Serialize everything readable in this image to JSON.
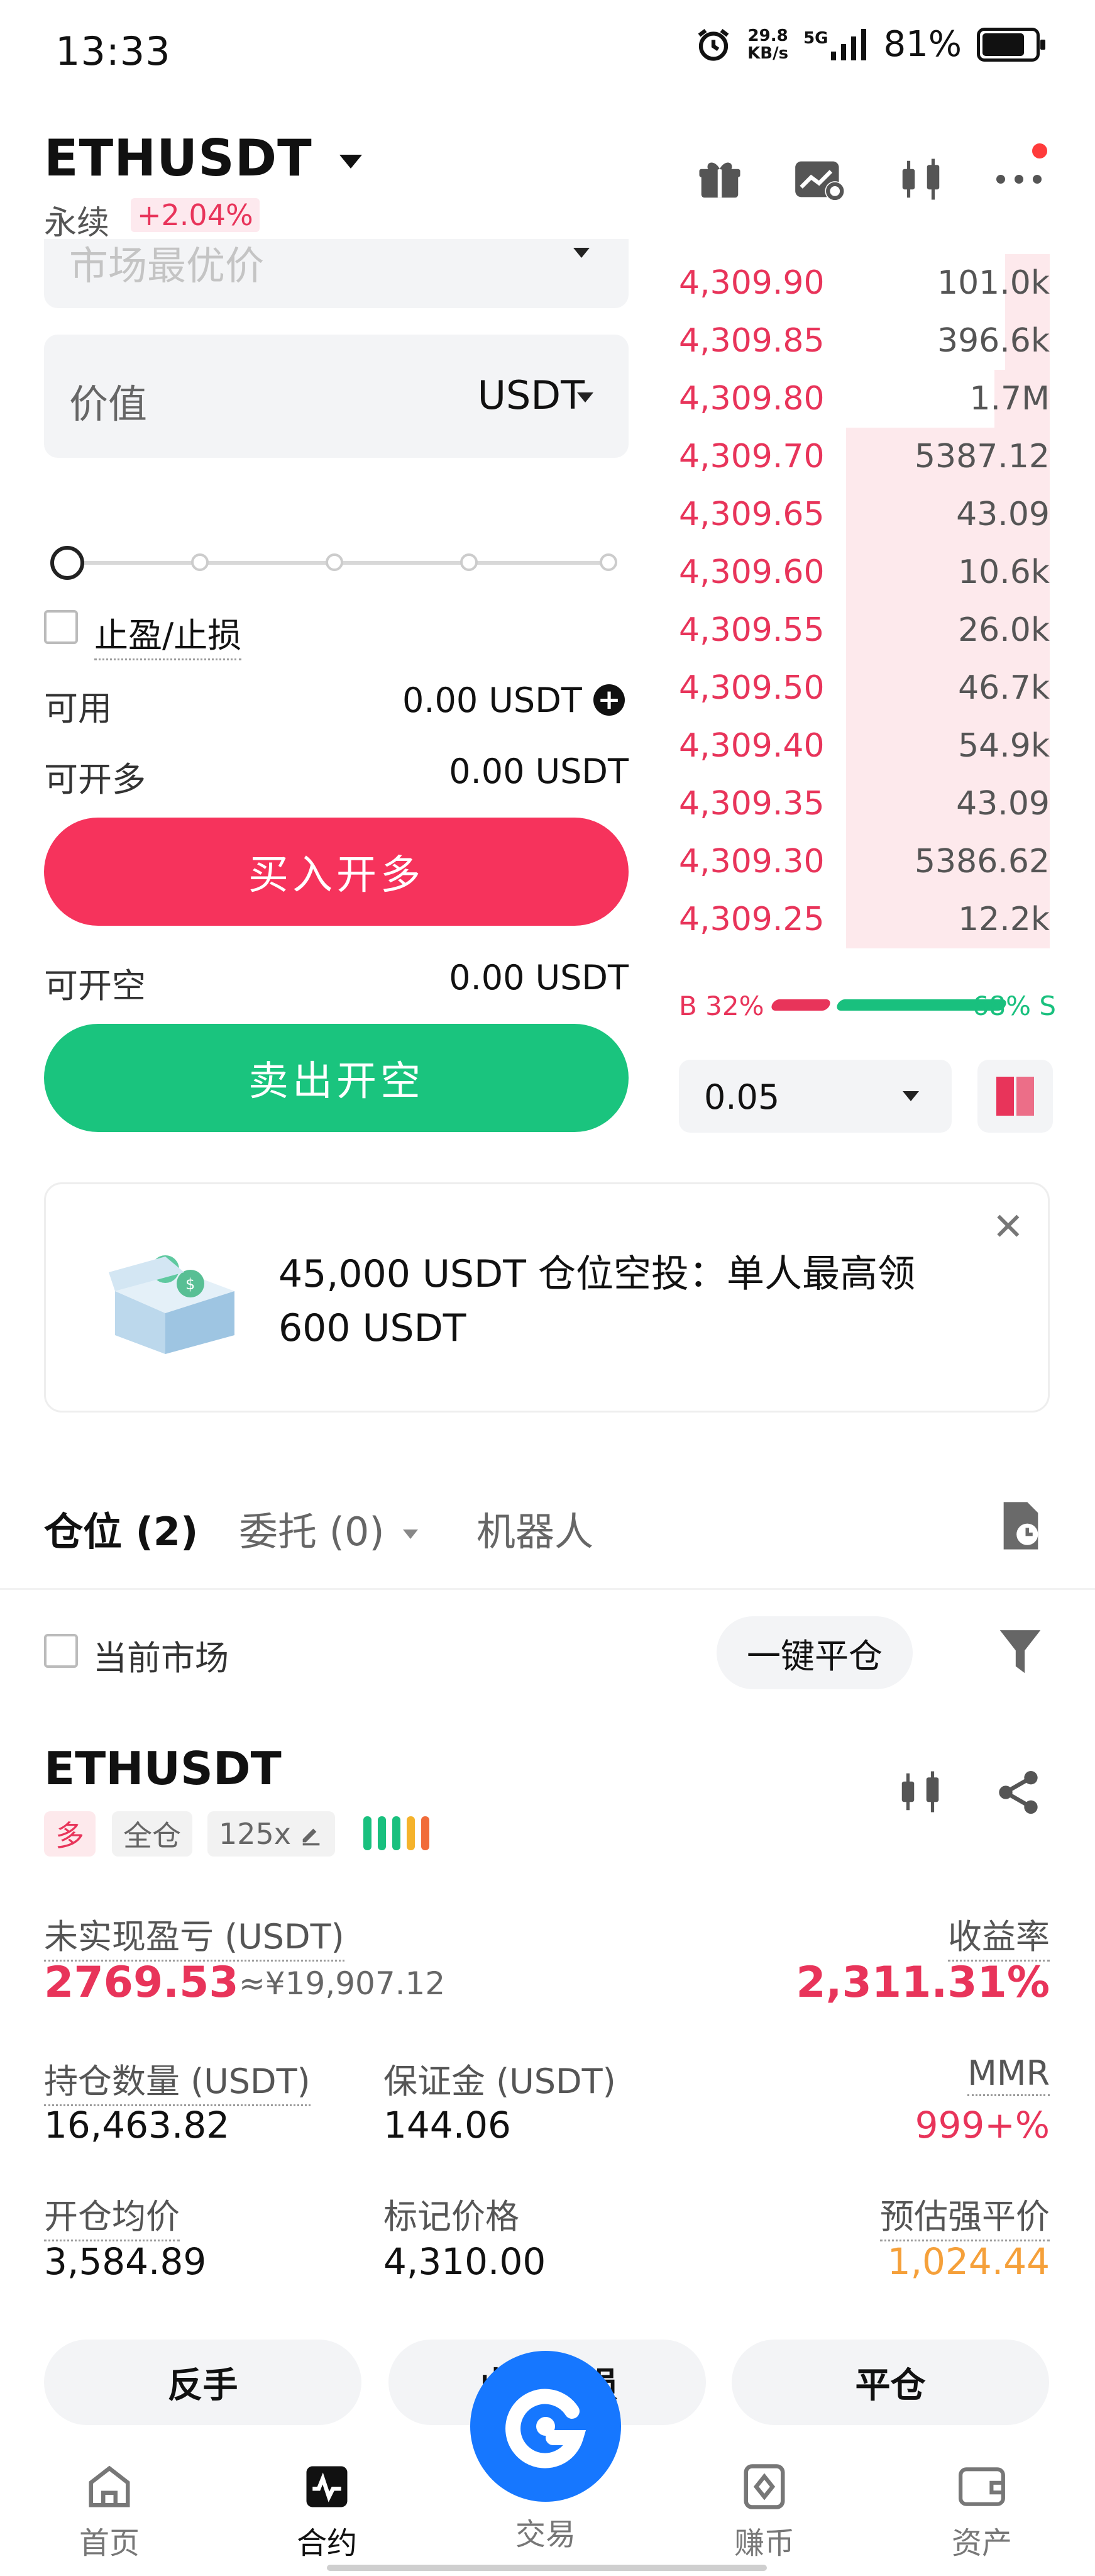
{
  "status_bar": {
    "time": "13:33",
    "net_speed_value": "29.8",
    "net_speed_unit": "KB/s",
    "network": "5G",
    "battery": "81%"
  },
  "header": {
    "symbol": "ETHUSDT",
    "market_type": "永续",
    "change": "+2.04%"
  },
  "order_form": {
    "order_type_placeholder": "市场最优价",
    "value_label": "价值",
    "value_unit": "USDT",
    "slider_level": 0,
    "tpsl_label": "止盈/止损",
    "available_label": "可用",
    "available_value": "0.00 USDT",
    "can_open_long_label": "可开多",
    "can_open_long_value": "0.00 USDT",
    "buy_button": "买入开多",
    "can_open_short_label": "可开空",
    "can_open_short_value": "0.00 USDT",
    "sell_button": "卖出开空"
  },
  "order_book": {
    "asks": [
      {
        "price": "4,309.90",
        "qty": "101.0k",
        "depth": 0.12
      },
      {
        "price": "4,309.85",
        "qty": "396.6k",
        "depth": 0.12
      },
      {
        "price": "4,309.80",
        "qty": "1.7M",
        "depth": 0.15
      },
      {
        "price": "4,309.70",
        "qty": "5387.12",
        "depth": 0.55
      },
      {
        "price": "4,309.65",
        "qty": "43.09",
        "depth": 0.55
      },
      {
        "price": "4,309.60",
        "qty": "10.6k",
        "depth": 0.55
      },
      {
        "price": "4,309.55",
        "qty": "26.0k",
        "depth": 0.55
      },
      {
        "price": "4,309.50",
        "qty": "46.7k",
        "depth": 0.55
      },
      {
        "price": "4,309.40",
        "qty": "54.9k",
        "depth": 0.55
      },
      {
        "price": "4,309.35",
        "qty": "43.09",
        "depth": 0.55
      },
      {
        "price": "4,309.30",
        "qty": "5386.62",
        "depth": 0.55
      },
      {
        "price": "4,309.25",
        "qty": "12.2k",
        "depth": 0.55
      }
    ],
    "buy_ratio": "B 32%",
    "sell_ratio": "68% S",
    "precision": "0.05"
  },
  "banner": {
    "text": "45,000 USDT 仓位空投：单人最高领 600 USDT"
  },
  "tabs": {
    "positions": "仓位 (2)",
    "orders": "委托 (0)",
    "bots": "机器人"
  },
  "filters": {
    "current_market": "当前市场",
    "close_all": "一键平仓"
  },
  "position": {
    "symbol": "ETHUSDT",
    "side_tag": "多",
    "margin_tag": "全仓",
    "leverage": "125x",
    "upnl_label": "未实现盈亏 (USDT)",
    "upnl_value": "2769.53",
    "upnl_cny": "≈¥19,907.12",
    "roe_label": "收益率",
    "roe_value": "2,311.31%",
    "size_label": "持仓数量 (USDT)",
    "size_value": "16,463.82",
    "margin_label": "保证金 (USDT)",
    "margin_value": "144.06",
    "mmr_label": "MMR",
    "mmr_value": "999+%",
    "entry_label": "开仓均价",
    "entry_value": "3,584.89",
    "mark_label": "标记价格",
    "mark_value": "4,310.00",
    "liq_label": "预估强平价",
    "liq_value": "1,024.44",
    "btn_reverse": "反手",
    "btn_tpsl": "止盈止损",
    "btn_close": "平仓"
  },
  "bottom_nav": {
    "home": "首页",
    "futures": "合约",
    "trade": "交易",
    "earn": "赚币",
    "assets": "资产"
  },
  "colors": {
    "red": "#e8345a",
    "green": "#19c07e",
    "brand_blue": "#1677ff"
  }
}
